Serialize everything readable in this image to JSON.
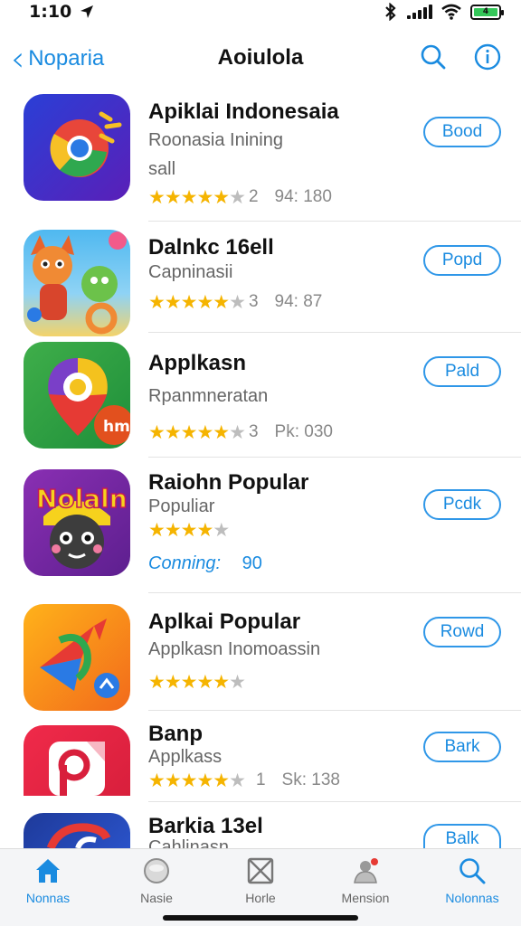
{
  "status": {
    "time": "1:10",
    "battery": "4"
  },
  "nav": {
    "back_label": "Noparia",
    "title": "Aoiulola"
  },
  "apps": [
    {
      "name": "Apiklai Indonesaia",
      "subtitle": "Roonasia Inining",
      "subtitle2": "sall",
      "stars": 5,
      "count": "2",
      "meta": "94: 180",
      "button": "Bood"
    },
    {
      "name": "Dalnkc 16ell",
      "subtitle": "Capninasii",
      "stars": 5,
      "count": "3",
      "meta": "94: 87",
      "button": "Popd"
    },
    {
      "name": "Applkasn",
      "subtitle": "Rpanmneratan",
      "stars": 5,
      "count": "3",
      "meta": "Pk: 030",
      "button": "Pald"
    },
    {
      "name": "Raiohn Popular",
      "subtitle": "Populiar",
      "stars": 4,
      "coming": "Conning:",
      "coming_value": "90",
      "button": "Pcdk",
      "icon_text": "Nolaln"
    },
    {
      "name": "Aplkai Popular",
      "subtitle": "Applkasn Inomoassin",
      "stars": 5,
      "button": "Rowd"
    },
    {
      "name": "Banp",
      "subtitle": "Applkass",
      "stars": 5,
      "count": "1",
      "meta": "Sk: 138",
      "button": "Bark"
    },
    {
      "name": "Barkia 13el",
      "subtitle": "Cahlinasn",
      "button": "Balk"
    }
  ],
  "tabs": [
    {
      "label": "Nonnas",
      "icon": "home-icon"
    },
    {
      "label": "Nasie",
      "icon": "circle-icon"
    },
    {
      "label": "Horle",
      "icon": "box-icon"
    },
    {
      "label": "Mension",
      "icon": "person-bell-icon"
    },
    {
      "label": "Nolonnas",
      "icon": "search-icon"
    }
  ],
  "colors": {
    "accent": "#1a8be0",
    "star": "#f5b400",
    "star_empty": "#bdbdbd"
  }
}
